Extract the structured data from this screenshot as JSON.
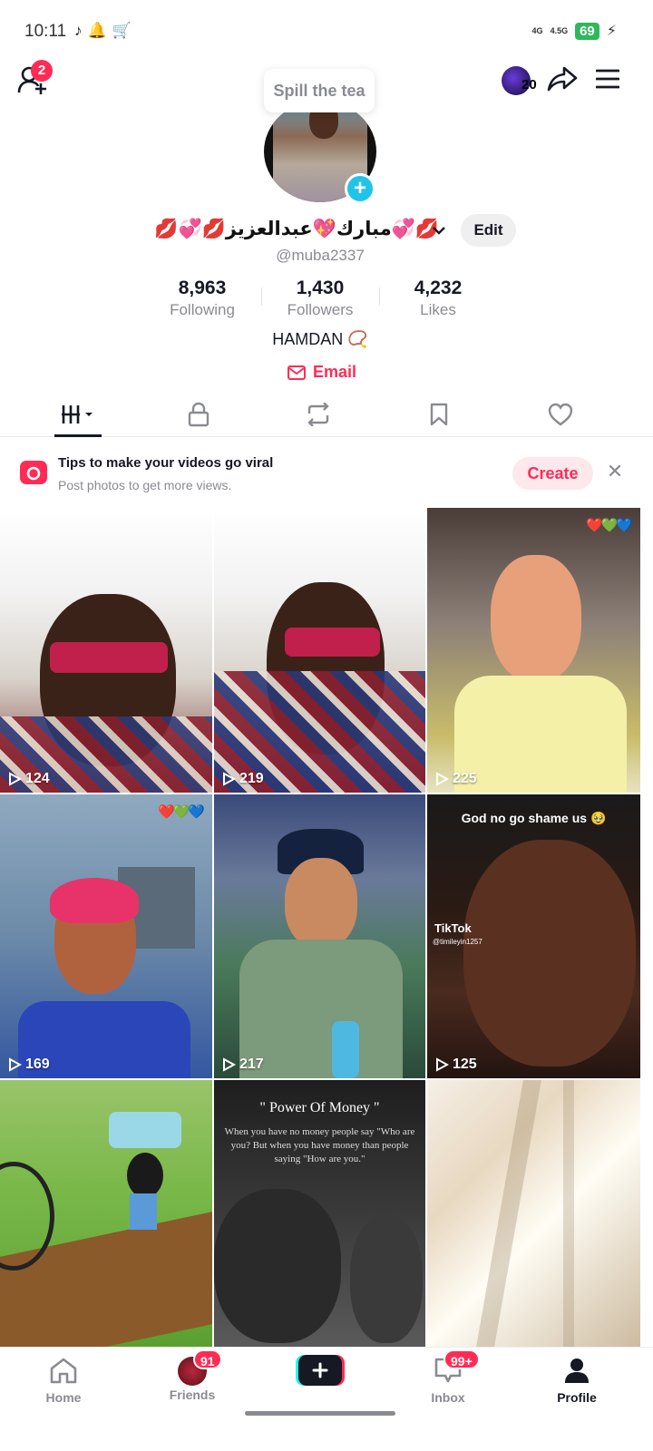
{
  "status_bar": {
    "time": "10:11",
    "battery": "69",
    "network_1": "4G",
    "network_2": "4.5G"
  },
  "header": {
    "friend_requests_badge": "2",
    "streak_count": "20"
  },
  "tooltip": {
    "text": "Spill the tea"
  },
  "profile": {
    "display_name": "💋💞مبارك💖عبدالعزيز💋💞💋",
    "edit_label": "Edit",
    "username": "@muba2337",
    "stats": [
      {
        "value": "8,963",
        "label": "Following"
      },
      {
        "value": "1,430",
        "label": "Followers"
      },
      {
        "value": "4,232",
        "label": "Likes"
      }
    ],
    "bio": "HAMDAN 📿",
    "email_label": "Email"
  },
  "tabs": [
    "videos",
    "private",
    "reposts",
    "favorites",
    "liked"
  ],
  "tip": {
    "title": "Tips to make your videos go viral",
    "subtitle": "Post photos to get more views.",
    "create_label": "Create"
  },
  "videos": [
    {
      "views": "124"
    },
    {
      "views": "219"
    },
    {
      "views": "225",
      "hearts": "❤️💚💙"
    },
    {
      "views": "169",
      "hearts": "❤️💚💙"
    },
    {
      "views": "217"
    },
    {
      "views": "125",
      "caption": "God no go shame us 🥹",
      "watermark": "TikTok",
      "watermark_handle": "@timileyin1257"
    },
    {
      "views": ""
    },
    {
      "views": "",
      "title": "\" Power Of Money \"",
      "quote": "When you have no money people say \"Who are you? But when you have money than people saying \"How are you.\""
    },
    {
      "views": ""
    }
  ],
  "bottom_nav": {
    "home": "Home",
    "friends": "Friends",
    "friends_badge": "91",
    "inbox": "Inbox",
    "inbox_badge": "99+",
    "profile": "Profile"
  },
  "colors": {
    "accent": "#fe2c55",
    "cyan": "#20c4e8",
    "muted": "#8a8b91",
    "text": "#161823"
  }
}
